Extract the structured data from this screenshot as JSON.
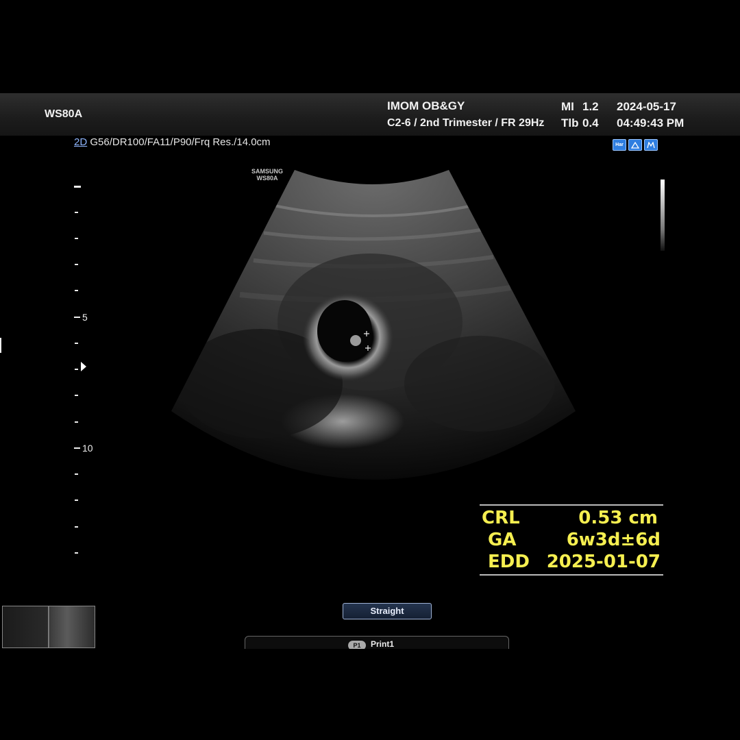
{
  "header": {
    "model": "WS80A",
    "institution": "IMOM OB&GY",
    "preset_line": "C2-6 / 2nd Trimester / FR 29Hz",
    "mi_label": "MI",
    "mi_value": "1.2",
    "tib_label": "Tlb",
    "tib_value": "0.4",
    "date": "2024-05-17",
    "time": "04:49:43 PM"
  },
  "imaging_params": {
    "mode": "2D",
    "settings": " G56/DR100/FA11/P90/Frq Res./14.0cm"
  },
  "status_icons": [
    {
      "name": "harmonic-icon",
      "text": "Har"
    },
    {
      "name": "probe-icon",
      "text": ""
    },
    {
      "name": "measure-icon",
      "text": ""
    }
  ],
  "brand": {
    "line1": "SAMSUNG",
    "line2": "WS80A"
  },
  "depth_scale": {
    "labels": [
      "5",
      "10"
    ]
  },
  "measurements": [
    {
      "label": "CRL",
      "value": "0.53 cm"
    },
    {
      "label": "GA",
      "value": "6w3d±6d"
    },
    {
      "label": "EDD",
      "value": "2025-01-07"
    }
  ],
  "colors": {
    "measurement_text": "#f6ef50",
    "button_border": "#9fb3d6",
    "status_icon": "#2f7ee0"
  },
  "buttons": {
    "straight": "Straight",
    "print_badge": "P1",
    "print": "Print1"
  }
}
